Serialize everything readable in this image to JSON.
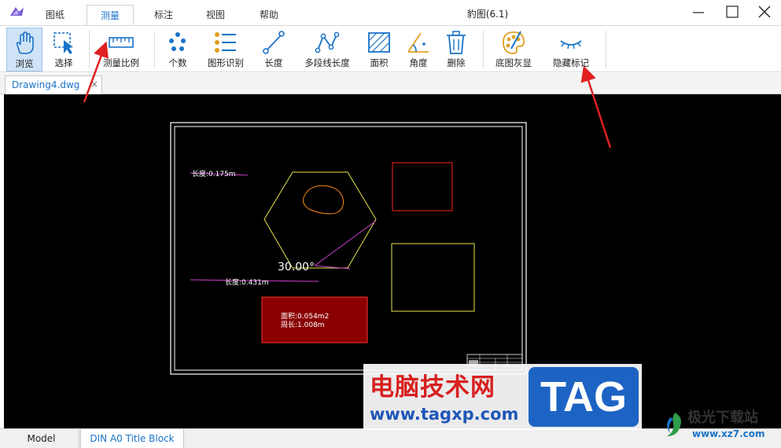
{
  "app": {
    "title": "豹图(6.1)"
  },
  "menu_tabs": [
    "图纸",
    "测量",
    "标注",
    "视图",
    "帮助"
  ],
  "active_tab": "测量",
  "toolbar": [
    {
      "label": "浏览",
      "icon": "hand-icon"
    },
    {
      "label": "选择",
      "icon": "cursor-select-icon"
    },
    {
      "label": "测量比例",
      "icon": "ruler-icon"
    },
    {
      "label": "个数",
      "icon": "dots-count-icon"
    },
    {
      "label": "图形识别",
      "icon": "shape-recognition-icon"
    },
    {
      "label": "长度",
      "icon": "length-icon"
    },
    {
      "label": "多段线长度",
      "icon": "polyline-length-icon"
    },
    {
      "label": "面积",
      "icon": "area-icon"
    },
    {
      "label": "角度",
      "icon": "angle-icon"
    },
    {
      "label": "删除",
      "icon": "trash-icon"
    },
    {
      "label": "底图灰显",
      "icon": "palette-icon"
    },
    {
      "label": "隐藏标记",
      "icon": "eye-closed-icon"
    }
  ],
  "document_tab": {
    "name": "Drawing4.dwg",
    "close": "×"
  },
  "drawing": {
    "annotations": {
      "length_top": "长度:0.175m",
      "length_bottom": "长度:0.431m",
      "angle": "30.00°",
      "area_line1": "面积:0.054m2",
      "area_line2": "周长:1.008m"
    }
  },
  "layout_tabs": [
    "Model",
    "DIN A0 Title Block"
  ],
  "watermark": {
    "brand_cn": "电脑技术网",
    "brand_url": "www.tagxp.com",
    "brand_tag": "TAG",
    "site_cn": "极光下载站",
    "site_url": "www.xz7.com"
  },
  "colors": {
    "accent": "#1a73c7",
    "canvas": "#000000",
    "arrow": "#e02020"
  }
}
